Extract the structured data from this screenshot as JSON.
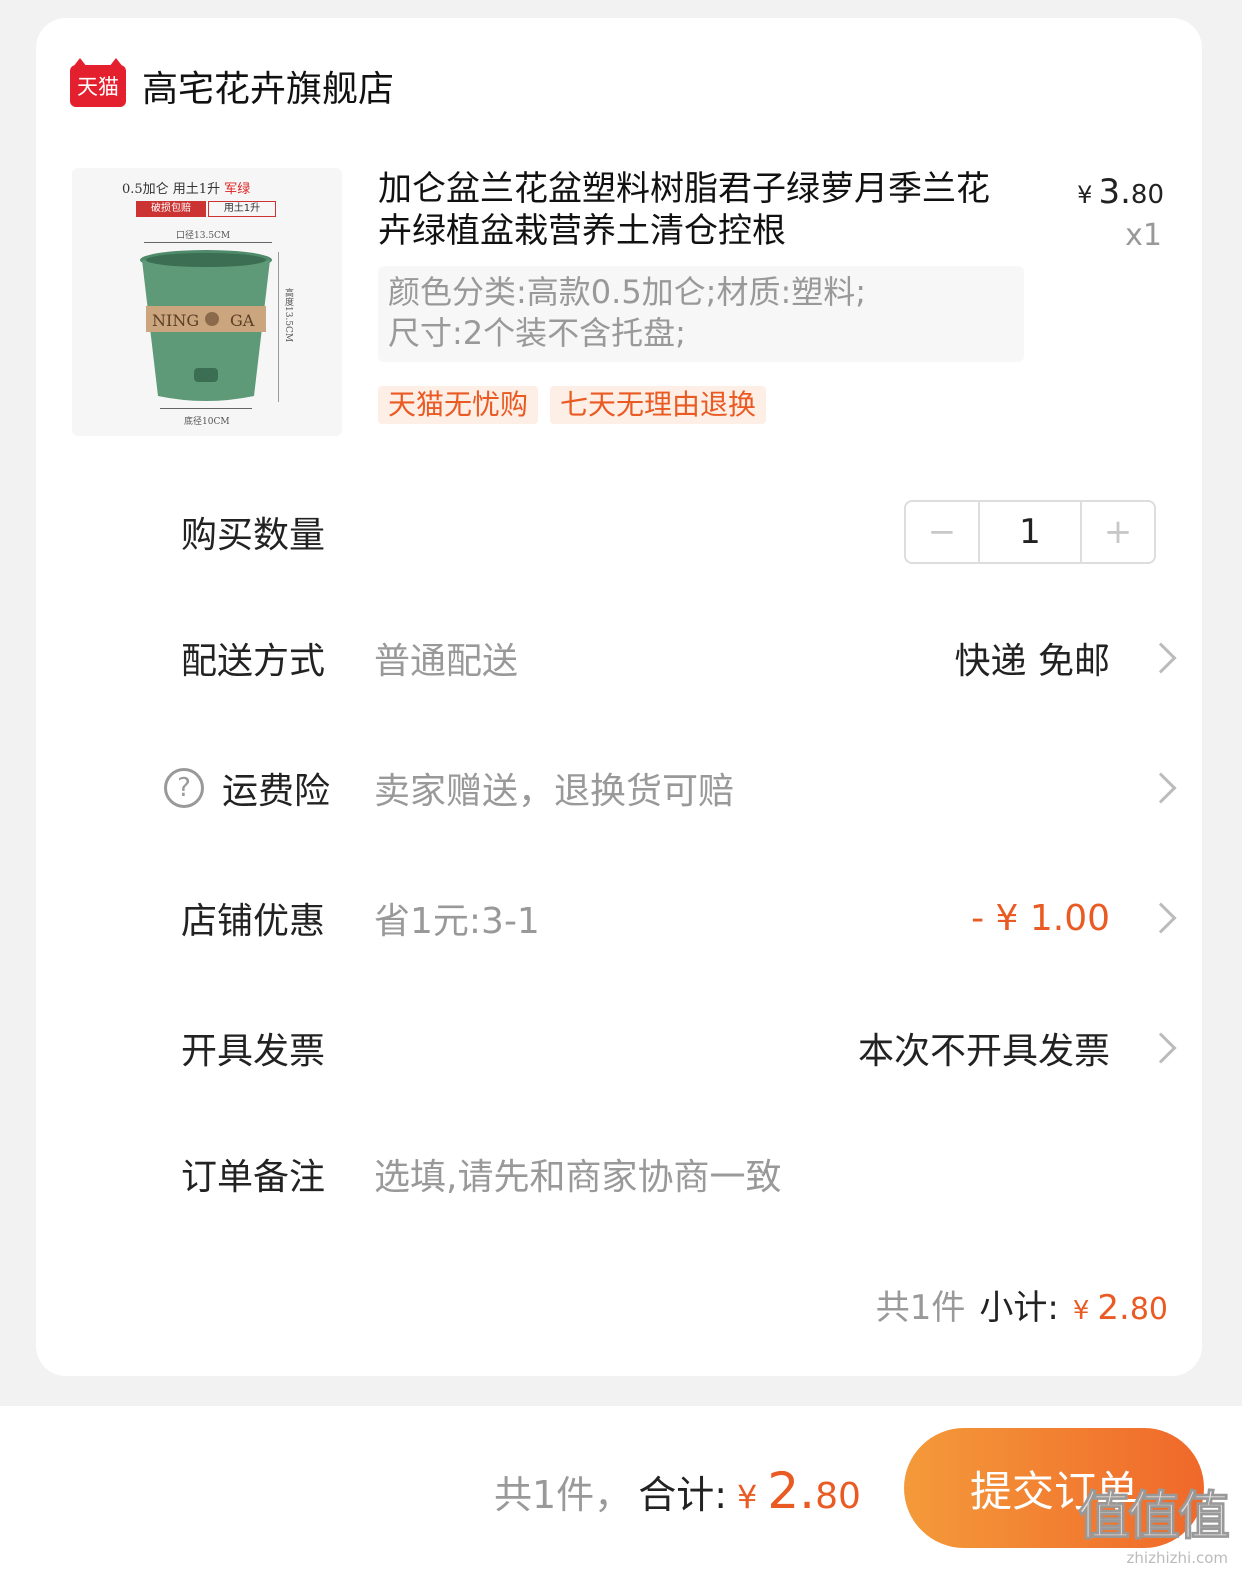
{
  "shop": {
    "logo_text": "天猫",
    "name": "高宅花卉旗舰店"
  },
  "product": {
    "image": {
      "line1": "0.5加仑  用土1升",
      "line1_red": "军绿",
      "tag1": "破损包赔",
      "tag2": "用土1升",
      "dim_top": "口径13.5CM",
      "dim_side": "高度13.5CM",
      "dim_bottom": "底径10CM"
    },
    "title": "加仑盆兰花盆塑料树脂君子绿萝月季兰花卉绿植盆栽营养土清仓控根",
    "price_currency": "¥",
    "price_int": "3.",
    "price_dec": "80",
    "quantity_label": "x1",
    "sku_line1": "颜色分类:高款0.5加仑;材质:塑料;",
    "sku_line2": "尺寸:2个装不含托盘;",
    "tags": [
      "天猫无忧购",
      "七天无理由退换"
    ]
  },
  "rows": {
    "quantity": {
      "label": "购买数量",
      "minus": "−",
      "value": "1",
      "plus": "+"
    },
    "delivery": {
      "label": "配送方式",
      "value": "普通配送",
      "right": "快递 免邮"
    },
    "insurance": {
      "icon": "?",
      "label": "运费险",
      "value": "卖家赠送，退换货可赔"
    },
    "discount": {
      "label": "店铺优惠",
      "value": "省1元:3-1",
      "right": "- ¥ 1.00"
    },
    "invoice": {
      "label": "开具发票",
      "right": "本次不开具发票"
    },
    "note": {
      "label": "订单备注",
      "placeholder": "选填,请先和商家协商一致"
    }
  },
  "subtotal": {
    "count": "共1件",
    "label": "小计:",
    "currency": "¥",
    "int": "2.",
    "dec": "80"
  },
  "bottom": {
    "count": "共1件，",
    "label": "合计:",
    "currency": "¥",
    "int": "2.",
    "dec": "80",
    "submit": "提交订单",
    "watermark": "值值值",
    "watermark_url": "zhizhizhi.com"
  },
  "colors": {
    "accent": "#ea5a23",
    "tmall_red": "#e5202e",
    "button_gradient_start": "#f49a3a",
    "button_gradient_end": "#f0682a"
  }
}
